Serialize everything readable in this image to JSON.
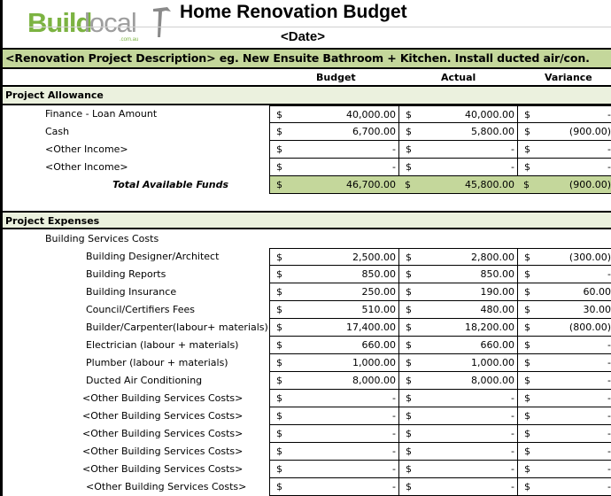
{
  "header": {
    "logo_main": "Build",
    "logo_secondary": "local",
    "logo_domain": ".com.au",
    "title": "Home Renovation Budget",
    "date": "<Date>"
  },
  "description": "<Renovation Project Description> eg. New Ensuite Bathroom + Kitchen. Install ducted air/con.",
  "columns": [
    "Budget",
    "Actual",
    "Variance"
  ],
  "currency_symbol": "$",
  "colors": {
    "accent_green": "#c4d79b",
    "section_bg": "#ebf1de",
    "logo_green": "#7cb342",
    "logo_grey": "#9e9e9e"
  },
  "allowance": {
    "heading": "Project Allowance",
    "rows": [
      {
        "label": "Finance - Loan Amount",
        "budget": "40,000.00",
        "actual": "40,000.00",
        "variance": "-"
      },
      {
        "label": "Cash",
        "budget": "6,700.00",
        "actual": "5,800.00",
        "variance": "(900.00)"
      },
      {
        "label": "<Other Income>",
        "budget": "-",
        "actual": "-",
        "variance": "-"
      },
      {
        "label": "<Other Income>",
        "budget": "-",
        "actual": "-",
        "variance": "-"
      }
    ],
    "total": {
      "label": "Total Available Funds",
      "budget": "46,700.00",
      "actual": "45,800.00",
      "variance": "(900.00)"
    }
  },
  "expenses": {
    "heading": "Project Expenses",
    "subheading": "Building Services Costs",
    "rows": [
      {
        "label": "Building Designer/Architect",
        "budget": "2,500.00",
        "actual": "2,800.00",
        "variance": "(300.00)"
      },
      {
        "label": "Building Reports",
        "budget": "850.00",
        "actual": "850.00",
        "variance": "-"
      },
      {
        "label": "Building Insurance",
        "budget": "250.00",
        "actual": "190.00",
        "variance": "60.00"
      },
      {
        "label": "Council/Certifiers Fees",
        "budget": "510.00",
        "actual": "480.00",
        "variance": "30.00"
      },
      {
        "label": "Builder/Carpenter(labour+ materials)",
        "budget": "17,400.00",
        "actual": "18,200.00",
        "variance": "(800.00)"
      },
      {
        "label": "Electrician (labour + materials)",
        "budget": "660.00",
        "actual": "660.00",
        "variance": "-"
      },
      {
        "label": "Plumber (labour + materials)",
        "budget": "1,000.00",
        "actual": "1,000.00",
        "variance": "-"
      },
      {
        "label": "Ducted Air Conditioning",
        "budget": "8,000.00",
        "actual": "8,000.00",
        "variance": "-"
      },
      {
        "label": "<Other Building Services Costs>",
        "budget": "-",
        "actual": "-",
        "variance": "-"
      },
      {
        "label": "<Other Building Services Costs>",
        "budget": "-",
        "actual": "-",
        "variance": "-"
      },
      {
        "label": "<Other Building Services Costs>",
        "budget": "-",
        "actual": "-",
        "variance": "-"
      },
      {
        "label": "<Other Building Services Costs>",
        "budget": "-",
        "actual": "-",
        "variance": "-"
      },
      {
        "label": "<Other Building Services Costs>",
        "budget": "-",
        "actual": "-",
        "variance": "-"
      },
      {
        "label": "<Other Building Services Costs>",
        "budget": "-",
        "actual": "-",
        "variance": "-"
      }
    ]
  }
}
